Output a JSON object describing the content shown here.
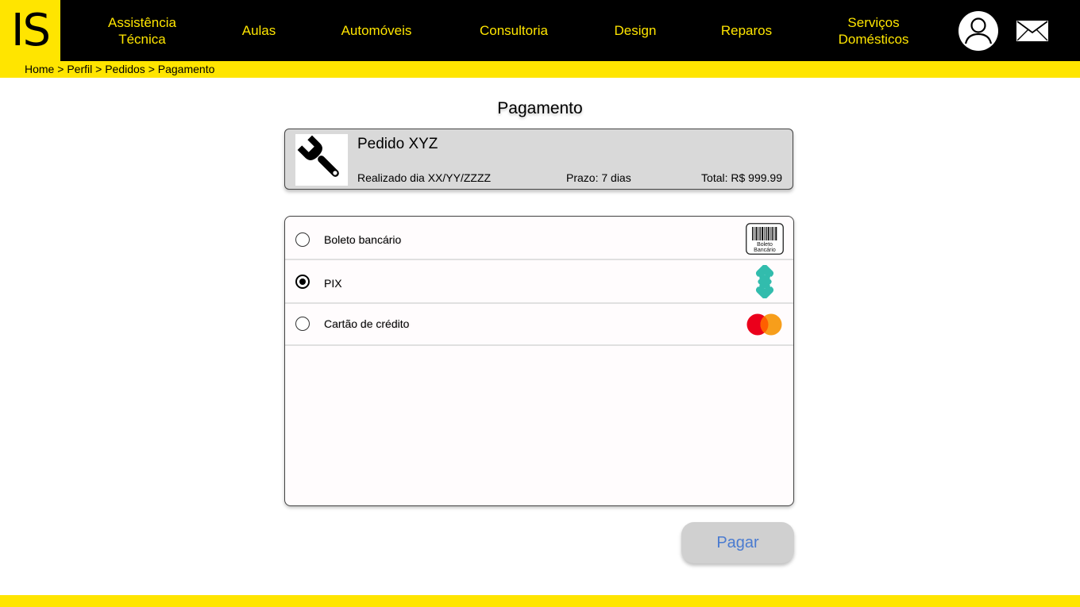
{
  "header": {
    "logo_text": "IS",
    "nav": [
      {
        "line1": "Assistência",
        "line2": "Técnica"
      },
      {
        "line1": "Aulas",
        "line2": ""
      },
      {
        "line1": "Automóveis",
        "line2": ""
      },
      {
        "line1": "Consultoria",
        "line2": ""
      },
      {
        "line1": "Design",
        "line2": ""
      },
      {
        "line1": "Reparos",
        "line2": ""
      },
      {
        "line1": "Serviços",
        "line2": "Domésticos"
      }
    ],
    "icons": {
      "profile": "user-avatar-icon",
      "messages": "envelope-icon"
    }
  },
  "breadcrumb": {
    "items": [
      "Home",
      "Perfil",
      "Pedidos",
      "Pagamento"
    ],
    "separator": ">"
  },
  "page": {
    "title": "Pagamento"
  },
  "order": {
    "name": "Pedido XYZ",
    "date": "Realizado dia XX/YY/ZZZZ",
    "deadline": "Prazo: 7 dias",
    "total": "Total: R$ 999.99",
    "thumbnail_icon": "wrench-icon"
  },
  "payment_methods": [
    {
      "label": "Boleto bancário",
      "selected": false,
      "icon": "barcode-icon",
      "icon_text_line1": "Boleto",
      "icon_text_line2": "Bancário"
    },
    {
      "label": "PIX",
      "selected": true,
      "icon": "pix-icon"
    },
    {
      "label": "Cartão de crédito",
      "selected": false,
      "icon": "mastercard-icon"
    }
  ],
  "actions": {
    "pay_label": "Pagar"
  },
  "colors": {
    "brand_yellow": "#FFE500",
    "header_black": "#000000",
    "card_gray": "#D9D9D9",
    "button_gray": "#D0D0D0",
    "button_text": "#4A7BD0",
    "pix_teal": "#32BCAD",
    "mastercard_red": "#EB001B",
    "mastercard_orange": "#F79E1B"
  }
}
